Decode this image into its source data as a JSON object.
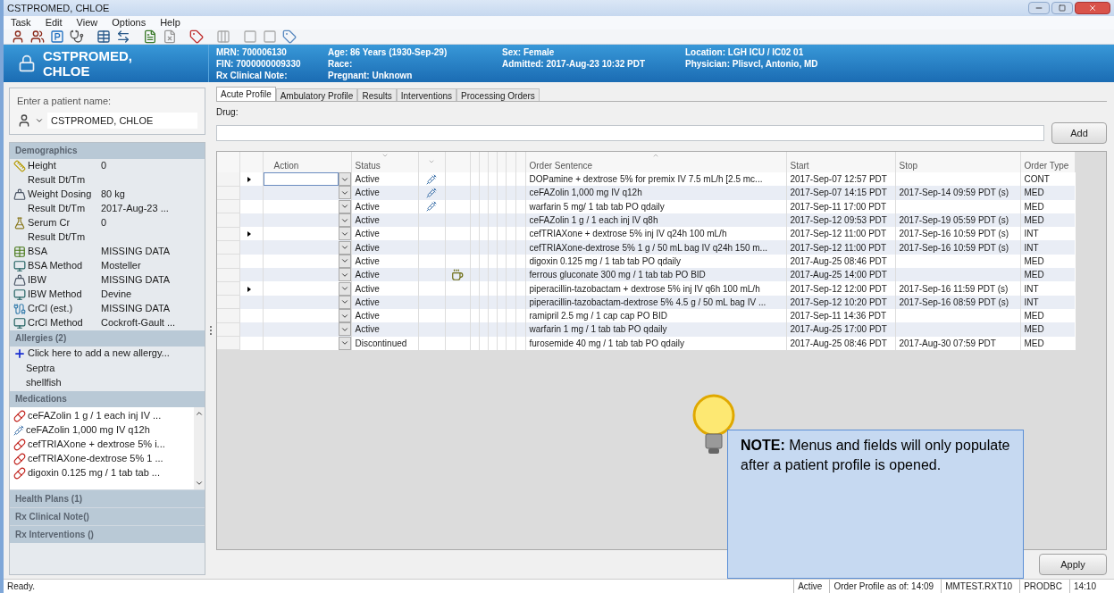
{
  "window": {
    "title": "CSTPROMED, CHLOE"
  },
  "menu": [
    "Task",
    "Edit",
    "View",
    "Options",
    "Help"
  ],
  "patient": {
    "name": "CSTPROMED, CHLOE",
    "info_columns": [
      [
        "MRN: 700006130",
        "FIN: 7000000009330",
        "Rx Clinical Note:"
      ],
      [
        "Age: 86 Years (1930-Sep-29)",
        "Race:",
        "Pregnant: Unknown"
      ],
      [
        "Sex: Female",
        "Admitted: 2017-Aug-23 10:32 PDT"
      ],
      [
        "Location: LGH ICU / IC02 01",
        "Physician: Plisvcl, Antonio, MD"
      ]
    ]
  },
  "patient_search": {
    "label": "Enter a patient name:",
    "value": "CSTPROMED, CHLOE"
  },
  "demographics": {
    "title": "Demographics",
    "items": [
      {
        "kind": "height",
        "label": "Height",
        "value": "0"
      },
      {
        "kind": "none",
        "label": "Result Dt/Tm"
      },
      {
        "kind": "weight",
        "label": "Weight Dosing",
        "value": "80  kg"
      },
      {
        "kind": "none",
        "label": "Result Dt/Tm",
        "value": "2017-Aug-23 ..."
      },
      {
        "kind": "flask",
        "label": "Serum Cr",
        "value": "0"
      },
      {
        "kind": "none",
        "label": "Result Dt/Tm"
      },
      {
        "kind": "bsa",
        "label": "BSA",
        "value": "MISSING DATA"
      },
      {
        "kind": "method",
        "label": "BSA Method",
        "value": "Mosteller"
      },
      {
        "kind": "weight",
        "label": "IBW",
        "value": "MISSING DATA"
      },
      {
        "kind": "method",
        "label": "IBW Method",
        "value": "Devine"
      },
      {
        "kind": "crcl",
        "label": "CrCl (est.)",
        "value": "MISSING DATA"
      },
      {
        "kind": "method",
        "label": "CrCl Method",
        "value": "Cockroft-Gault ..."
      }
    ]
  },
  "allergies": {
    "title": "Allergies (2)",
    "add_link": "Click here to add a new allergy...",
    "items": [
      "Septra",
      "shellfish"
    ]
  },
  "medications": {
    "title": "Medications",
    "items": [
      {
        "kind": "bag",
        "text": "ceFAZolin 1 g / 1 each inj IV ..."
      },
      {
        "kind": "iv",
        "text": "ceFAZolin 1,000 mg  IV q12h"
      },
      {
        "kind": "bag",
        "text": "cefTRIAXone + dextrose 5% i..."
      },
      {
        "kind": "bag",
        "text": "cefTRIAXone-dextrose 5% 1 ..."
      },
      {
        "kind": "bag",
        "text": "digoxin 0.125 mg / 1 tab tab ..."
      }
    ]
  },
  "collapsed_sections": [
    "Health Plans (1)",
    "Rx Clinical Note()",
    "Rx Interventions ()"
  ],
  "tabs": [
    {
      "label": "Acute Profile",
      "selected": true
    },
    {
      "label": "Ambulatory Profile",
      "selected": false
    },
    {
      "label": "Results",
      "selected": false
    },
    {
      "label": "Interventions",
      "selected": false
    },
    {
      "label": "Processing Orders",
      "selected": false
    }
  ],
  "drug_field": {
    "label": "Drug:"
  },
  "add_button": "Add",
  "table": {
    "columns": [
      "Action",
      "Status",
      "Order Sentence",
      "Start",
      "Stop",
      "Order Type"
    ],
    "rows": [
      {
        "expand": true,
        "selected": true,
        "status": "Active",
        "kind": "iv",
        "order": "DOPamine + dextrose 5% for premix  IV  7.5 mL/h [2.5 mc...",
        "start": "2017-Sep-07 12:57 PDT",
        "stop": "",
        "type": "CONT"
      },
      {
        "expand": false,
        "selected": false,
        "status": "Active",
        "kind": "iv",
        "order": "ceFAZolin 1,000 mg  IV q12h",
        "start": "2017-Sep-07 14:15 PDT",
        "stop": "2017-Sep-14 09:59 PDT (s)",
        "type": "MED"
      },
      {
        "expand": false,
        "selected": false,
        "status": "Active",
        "kind": "iv",
        "order": "warfarin 5 mg/ 1 tab tab PO qdaily",
        "start": "2017-Sep-11 17:00 PDT",
        "stop": "",
        "type": "MED"
      },
      {
        "expand": false,
        "selected": false,
        "status": "Active",
        "kind": "none",
        "order": "ceFAZolin 1 g / 1 each inj IV q8h",
        "start": "2017-Sep-12 09:53 PDT",
        "stop": "2017-Sep-19 05:59 PDT (s)",
        "type": "MED"
      },
      {
        "expand": true,
        "selected": false,
        "status": "Active",
        "kind": "none",
        "order": "cefTRIAXone + dextrose 5% inj IV q24h 100 mL/h",
        "start": "2017-Sep-12 11:00 PDT",
        "stop": "2017-Sep-16 10:59 PDT (s)",
        "type": "INT"
      },
      {
        "expand": false,
        "selected": false,
        "status": "Active",
        "kind": "none",
        "order": "cefTRIAXone-dextrose 5% 1 g / 50 mL bag IV q24h 150 m...",
        "start": "2017-Sep-12 11:00 PDT",
        "stop": "2017-Sep-16 10:59 PDT (s)",
        "type": "INT"
      },
      {
        "expand": false,
        "selected": false,
        "status": "Active",
        "kind": "none",
        "order": "digoxin 0.125 mg / 1 tab tab PO qdaily",
        "start": "2017-Aug-25 08:46 PDT",
        "stop": "",
        "type": "MED"
      },
      {
        "expand": false,
        "selected": false,
        "status": "Active",
        "kind": "cup",
        "order": "ferrous gluconate 300 mg / 1 tab tab PO BID",
        "start": "2017-Aug-25 14:00 PDT",
        "stop": "",
        "type": "MED"
      },
      {
        "expand": true,
        "selected": false,
        "status": "Active",
        "kind": "none",
        "order": "piperacillin-tazobactam + dextrose 5% inj IV q6h 100 mL/h",
        "start": "2017-Sep-12 12:00 PDT",
        "stop": "2017-Sep-16 11:59 PDT (s)",
        "type": "INT"
      },
      {
        "expand": false,
        "selected": false,
        "status": "Active",
        "kind": "none",
        "order": "piperacillin-tazobactam-dextrose 5% 4.5 g / 50 mL bag IV ...",
        "start": "2017-Sep-12 10:20 PDT",
        "stop": "2017-Sep-16 08:59 PDT (s)",
        "type": "INT"
      },
      {
        "expand": false,
        "selected": false,
        "status": "Active",
        "kind": "none",
        "order": "ramipril 2.5 mg / 1 cap cap PO BID",
        "start": "2017-Sep-11 14:36 PDT",
        "stop": "",
        "type": "MED"
      },
      {
        "expand": false,
        "selected": false,
        "status": "Active",
        "kind": "none",
        "order": "warfarin 1 mg / 1 tab tab PO qdaily",
        "start": "2017-Aug-25 17:00 PDT",
        "stop": "",
        "type": "MED"
      },
      {
        "expand": false,
        "selected": false,
        "status": "Discontinued",
        "kind": "none",
        "order": "furosemide 40 mg / 1 tab tab PO qdaily",
        "start": "2017-Aug-25 08:46 PDT",
        "stop": "2017-Aug-30 07:59 PDT",
        "type": "MED"
      }
    ]
  },
  "apply_button": "Apply",
  "note": "**NOTE:** Menus and fields will only populate after a patient profile is opened.",
  "status_bar": {
    "text": "Ready.",
    "panes": [
      "Active",
      "Order Profile as of: 14:09",
      "MMTEST.RXT10",
      "PRODBC",
      "14:10"
    ]
  }
}
